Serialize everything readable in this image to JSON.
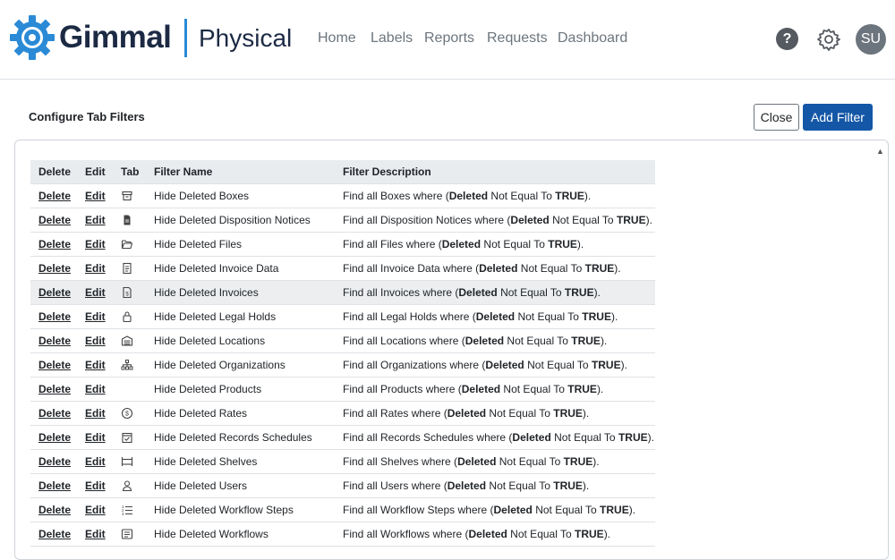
{
  "header": {
    "brand": "Gimmal",
    "product": "Physical",
    "nav": [
      "Home",
      "Labels",
      "Reports",
      "Requests",
      "Dashboard"
    ],
    "help_label": "?",
    "avatar_initials": "SU"
  },
  "page": {
    "title": "Configure Tab Filters",
    "close_label": "Close",
    "add_filter_label": "Add Filter"
  },
  "table": {
    "headers": {
      "delete": "Delete",
      "edit": "Edit",
      "tab": "Tab",
      "name": "Filter Name",
      "description": "Filter Description"
    },
    "rows": [
      {
        "delete": "Delete",
        "edit": "Edit",
        "icon": "archive-box-icon",
        "name": "Hide Deleted Boxes",
        "desc_prefix": "Find all Boxes where (",
        "field": "Deleted",
        "op": " Not Equal To ",
        "value": "TRUE",
        "desc_suffix": ")."
      },
      {
        "delete": "Delete",
        "edit": "Edit",
        "icon": "document-notice-icon",
        "name": "Hide Deleted Disposition Notices",
        "desc_prefix": "Find all Disposition Notices where (",
        "field": "Deleted",
        "op": " Not Equal To ",
        "value": "TRUE",
        "desc_suffix": ")."
      },
      {
        "delete": "Delete",
        "edit": "Edit",
        "icon": "folder-open-icon",
        "name": "Hide Deleted Files",
        "desc_prefix": "Find all Files where (",
        "field": "Deleted",
        "op": " Not Equal To ",
        "value": "TRUE",
        "desc_suffix": ")."
      },
      {
        "delete": "Delete",
        "edit": "Edit",
        "icon": "document-text-icon",
        "name": "Hide Deleted Invoice Data",
        "desc_prefix": "Find all Invoice Data where (",
        "field": "Deleted",
        "op": " Not Equal To ",
        "value": "TRUE",
        "desc_suffix": ")."
      },
      {
        "delete": "Delete",
        "edit": "Edit",
        "icon": "invoice-icon",
        "name": "Hide Deleted Invoices",
        "desc_prefix": "Find all Invoices where (",
        "field": "Deleted",
        "op": " Not Equal To ",
        "value": "TRUE",
        "desc_suffix": ")."
      },
      {
        "delete": "Delete",
        "edit": "Edit",
        "icon": "lock-icon",
        "name": "Hide Deleted Legal Holds",
        "desc_prefix": "Find all Legal Holds where (",
        "field": "Deleted",
        "op": " Not Equal To ",
        "value": "TRUE",
        "desc_suffix": ")."
      },
      {
        "delete": "Delete",
        "edit": "Edit",
        "icon": "warehouse-icon",
        "name": "Hide Deleted Locations",
        "desc_prefix": "Find all Locations where (",
        "field": "Deleted",
        "op": " Not Equal To ",
        "value": "TRUE",
        "desc_suffix": ")."
      },
      {
        "delete": "Delete",
        "edit": "Edit",
        "icon": "org-chart-icon",
        "name": "Hide Deleted Organizations",
        "desc_prefix": "Find all Organizations where (",
        "field": "Deleted",
        "op": " Not Equal To ",
        "value": "TRUE",
        "desc_suffix": ")."
      },
      {
        "delete": "Delete",
        "edit": "Edit",
        "icon": "",
        "name": "Hide Deleted Products",
        "desc_prefix": "Find all Products where (",
        "field": "Deleted",
        "op": " Not Equal To ",
        "value": "TRUE",
        "desc_suffix": ")."
      },
      {
        "delete": "Delete",
        "edit": "Edit",
        "icon": "dollar-circle-icon",
        "name": "Hide Deleted Rates",
        "desc_prefix": "Find all Rates where (",
        "field": "Deleted",
        "op": " Not Equal To ",
        "value": "TRUE",
        "desc_suffix": ")."
      },
      {
        "delete": "Delete",
        "edit": "Edit",
        "icon": "calendar-check-icon",
        "name": "Hide Deleted Records Schedules",
        "desc_prefix": "Find all Records Schedules where (",
        "field": "Deleted",
        "op": " Not Equal To ",
        "value": "TRUE",
        "desc_suffix": ")."
      },
      {
        "delete": "Delete",
        "edit": "Edit",
        "icon": "shelf-icon",
        "name": "Hide Deleted Shelves",
        "desc_prefix": "Find all Shelves where (",
        "field": "Deleted",
        "op": " Not Equal To ",
        "value": "TRUE",
        "desc_suffix": ")."
      },
      {
        "delete": "Delete",
        "edit": "Edit",
        "icon": "user-icon",
        "name": "Hide Deleted Users",
        "desc_prefix": "Find all Users where (",
        "field": "Deleted",
        "op": " Not Equal To ",
        "value": "TRUE",
        "desc_suffix": ")."
      },
      {
        "delete": "Delete",
        "edit": "Edit",
        "icon": "list-ordered-icon",
        "name": "Hide Deleted Workflow Steps",
        "desc_prefix": "Find all Workflow Steps where (",
        "field": "Deleted",
        "op": " Not Equal To ",
        "value": "TRUE",
        "desc_suffix": ")."
      },
      {
        "delete": "Delete",
        "edit": "Edit",
        "icon": "workflow-icon",
        "name": "Hide Deleted Workflows",
        "desc_prefix": "Find all Workflows where (",
        "field": "Deleted",
        "op": " Not Equal To ",
        "value": "TRUE",
        "desc_suffix": ")."
      }
    ]
  },
  "colors": {
    "brand_blue": "#2a8ad6",
    "primary_button": "#1357a6",
    "brand_dark": "#1c2a44"
  }
}
